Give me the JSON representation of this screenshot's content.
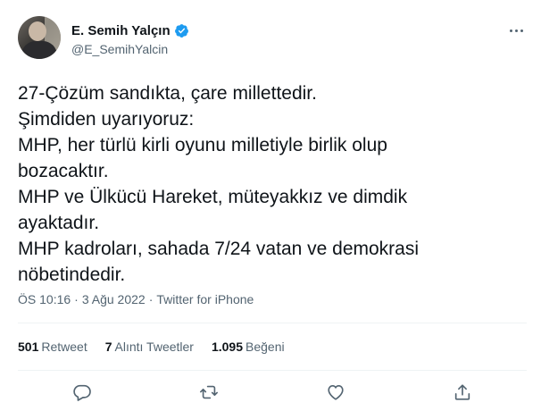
{
  "author": {
    "display_name": "E. Semih Yalçın",
    "handle": "@E_SemihYalcin",
    "verified": true,
    "verified_color": "#1d9bf0"
  },
  "tweet": {
    "lines": [
      "27-Çözüm sandıkta, çare millettedir.",
      "Şimdiden uyarıyoruz:",
      "MHP, her türlü kirli oyunu milletiyle birlik olup",
      "bozacaktır.",
      "MHP ve Ülkücü Hareket, müteyakkız ve dimdik",
      "ayaktadır.",
      "MHP kadroları, sahada 7/24 vatan ve demokrasi",
      "nöbetindedir."
    ]
  },
  "meta": {
    "time": "ÖS 10:16",
    "separator1": "·",
    "date": "3 Ağu 2022",
    "separator2": "·",
    "source": "Twitter for iPhone"
  },
  "stats": {
    "retweets_count": "501",
    "retweets_label": "Retweet",
    "quotes_count": "7",
    "quotes_label": "Alıntı Tweetler",
    "likes_count": "1.095",
    "likes_label": "Beğeni"
  },
  "icons": {
    "more": "more-horizontal-icon",
    "reply": "reply-icon",
    "retweet": "retweet-icon",
    "like": "heart-icon",
    "share": "share-icon",
    "icon_color": "#536471"
  }
}
